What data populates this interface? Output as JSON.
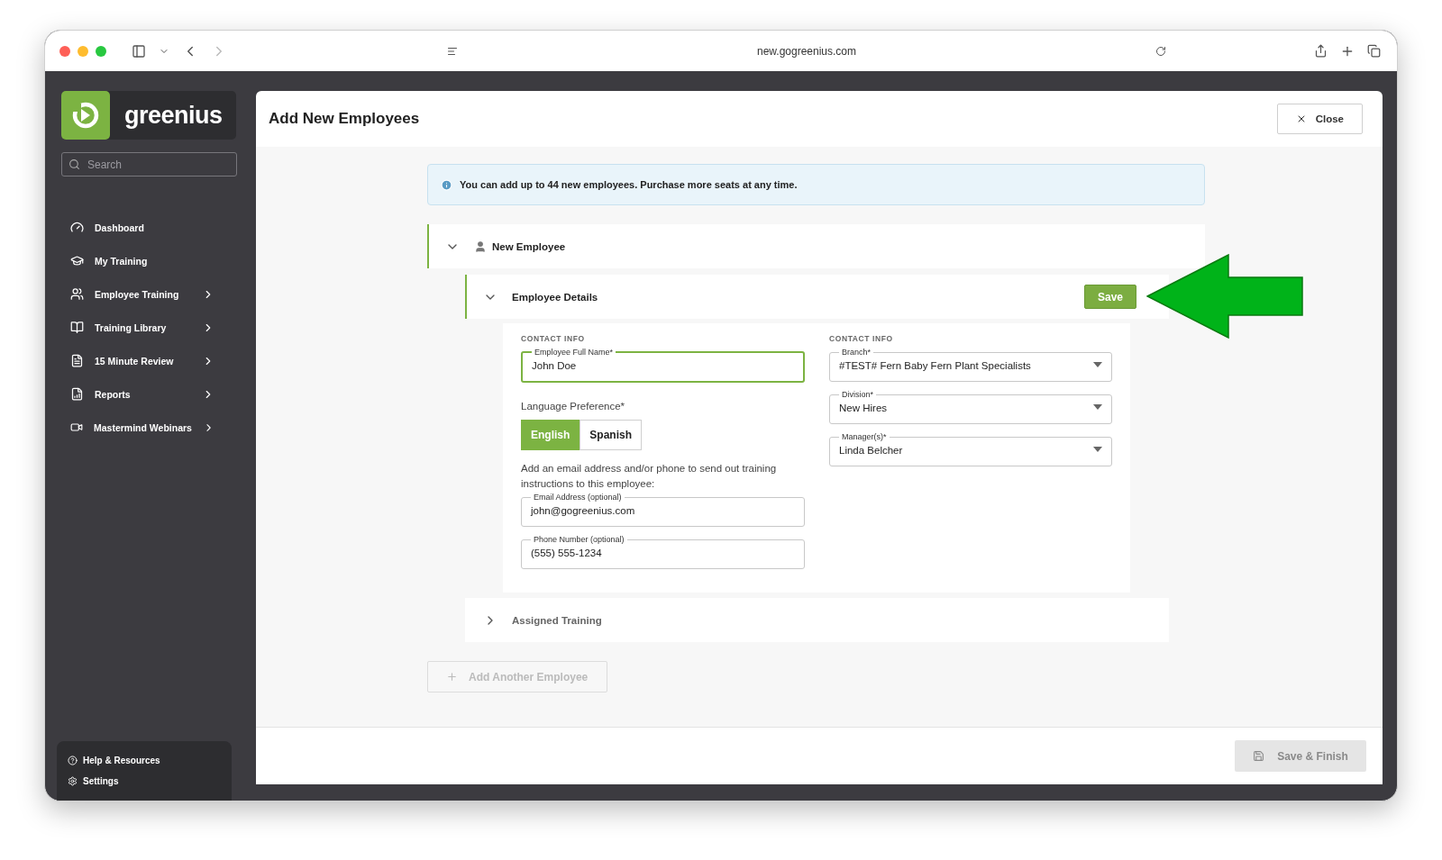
{
  "browser": {
    "url": "new.gogreenius.com"
  },
  "sidebar": {
    "brand": "greenius",
    "search": {
      "placeholder": "Search"
    },
    "items": [
      {
        "label": "Dashboard",
        "kind": "link"
      },
      {
        "label": "My Training",
        "kind": "link"
      },
      {
        "label": "Employee Training",
        "kind": "group"
      },
      {
        "label": "Training Library",
        "kind": "group"
      },
      {
        "label": "15 Minute Review",
        "kind": "group"
      },
      {
        "label": "Reports",
        "kind": "group"
      },
      {
        "label": "Mastermind Webinars",
        "kind": "group"
      }
    ],
    "footer_items": [
      {
        "label": "Help & Resources"
      },
      {
        "label": "Settings"
      }
    ]
  },
  "page": {
    "title": "Add New Employees",
    "close": "Close"
  },
  "notice": "You can add up to 44 new employees. Purchase more seats at any time.",
  "employee": {
    "title": "New Employee",
    "expanded": true,
    "details": {
      "title": "Employee Details",
      "expanded": true,
      "save": "Save",
      "left": {
        "section": "CONTACT INFO",
        "full_name": {
          "label": "Employee Full Name*",
          "value": "John Doe",
          "focused": true
        },
        "language": {
          "label": "Language Preference*",
          "options": [
            {
              "label": "English",
              "selected": true
            },
            {
              "label": "Spanish",
              "selected": false
            }
          ]
        },
        "hint": "Add an email address and/or phone to send out training instructions to this employee:",
        "contacts": [
          {
            "label": "Email Address (optional)",
            "value": "john@gogreenius.com",
            "focused": false
          },
          {
            "label": "Phone Number (optional)",
            "value": "(555) 555-1234",
            "focused": false
          }
        ]
      },
      "right": {
        "section": "CONTACT INFO",
        "selects": [
          {
            "label": "Branch*",
            "value": "#TEST# Fern Baby Fern Plant Specialists"
          },
          {
            "label": "Division*",
            "value": "New Hires"
          },
          {
            "label": "Manager(s)*",
            "value": "Linda Belcher"
          }
        ]
      }
    },
    "assigned_training": {
      "title": "Assigned Training",
      "expanded": false
    }
  },
  "add_employee": {
    "label": "Add Another Employee",
    "disabled": true
  },
  "save_finish": {
    "label": "Save & Finish",
    "disabled": true
  }
}
